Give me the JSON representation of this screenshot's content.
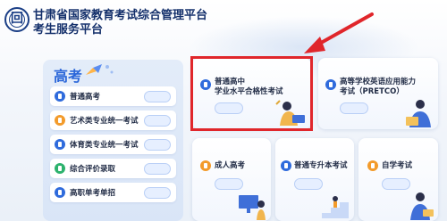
{
  "header": {
    "title_line1": "甘肃省国家教育考试综合管理平台",
    "title_line2": "考生服务平台"
  },
  "colors": {
    "brand": "#1b3f86",
    "accent": "#2a66d9",
    "highlight": "#e0262b",
    "orange": "#f39b2b"
  },
  "gaokao_panel": {
    "heading": "高考",
    "items": [
      {
        "label": "普通高考",
        "button": "",
        "icon": "document-icon",
        "icon_color": "#2f6bdc"
      },
      {
        "label": "艺术类专业统一考试",
        "button": "",
        "icon": "palette-icon",
        "icon_color": "#f39b2b"
      },
      {
        "label": "体育类专业统一考试",
        "button": "",
        "icon": "sport-icon",
        "icon_color": "#2f6bdc"
      },
      {
        "label": "综合评价录取",
        "button": "",
        "icon": "evaluation-icon",
        "icon_color": "#2db26d"
      },
      {
        "label": "高职单考单招",
        "button": "",
        "icon": "vocational-icon",
        "icon_color": "#2f6bdc"
      }
    ]
  },
  "cards": {
    "xueye": {
      "line1": "普通高中",
      "line2": "学业水平合格性考试",
      "button": "",
      "icon_color": "#2f6bdc"
    },
    "pretco": {
      "line1": "高等学校英语应用能力",
      "line2": "考试（PRETCO）",
      "button": "",
      "icon_color": "#2f6bdc"
    },
    "chengkao": {
      "label": "成人高考",
      "button": "",
      "icon_color": "#f39b2b"
    },
    "zhuanshengben": {
      "label": "普通专升本考试",
      "button": "",
      "icon_color": "#2f6bdc"
    },
    "zikao": {
      "label": "自学考试",
      "button": "",
      "icon_color": "#f39b2b"
    }
  }
}
